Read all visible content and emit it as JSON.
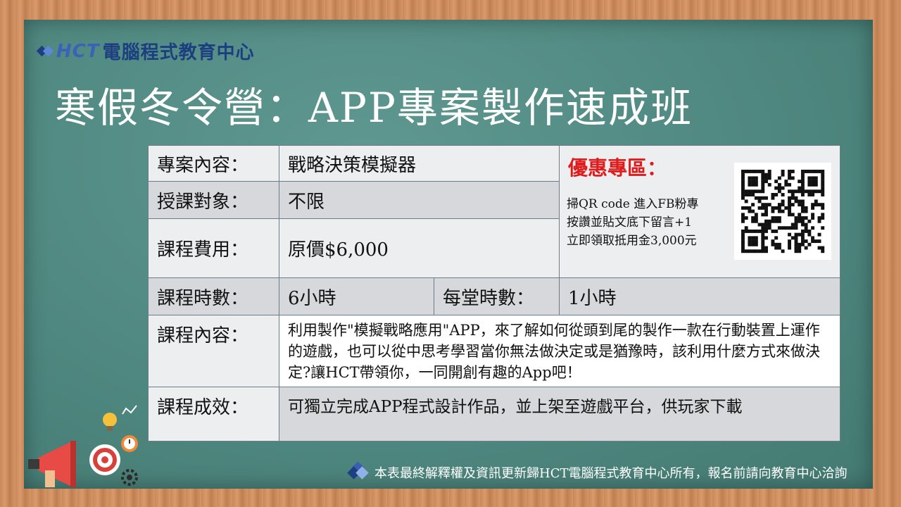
{
  "logo": {
    "brand": "HCT",
    "name": "電腦程式教育中心"
  },
  "title": "寒假冬令營：APP專案製作速成班",
  "table": {
    "project_label": "專案內容：",
    "project_value": "戰略決策模擬器",
    "target_label": "授課對象：",
    "target_value": "不限",
    "fee_label": "課程費用：",
    "fee_value": "原價$6,000",
    "hours_label": "課程時數：",
    "hours_value": "6小時",
    "per_class_label": "每堂時數：",
    "per_class_value": "1小時",
    "content_label": "課程內容：",
    "content_value": "利用製作\"模擬戰略應用\"APP，來了解如何從頭到尾的製作一款在行動裝置上運作的遊戲，也可以從中思考學習當你無法做決定或是猶豫時，該利用什麼方式來做決定?讓HCT帶領你，一同開創有趣的App吧！",
    "outcome_label": "課程成效：",
    "outcome_value": "可獨立完成APP程式設計作品，並上架至遊戲平台，供玩家下載"
  },
  "promo": {
    "title": "優惠專區：",
    "line1": "掃QR code 進入FB粉專",
    "line2": "按讚並貼文底下留言+1",
    "line3": "立即領取抵用金3,000元"
  },
  "footer": {
    "text": "本表最終解釋權及資訊更新歸HCT電腦程式教育中心所有，報名前請向教育中心洽詢"
  },
  "colors": {
    "board": "#4f8880",
    "promo_title": "#e01b1b",
    "logo": "#1d3f80"
  }
}
